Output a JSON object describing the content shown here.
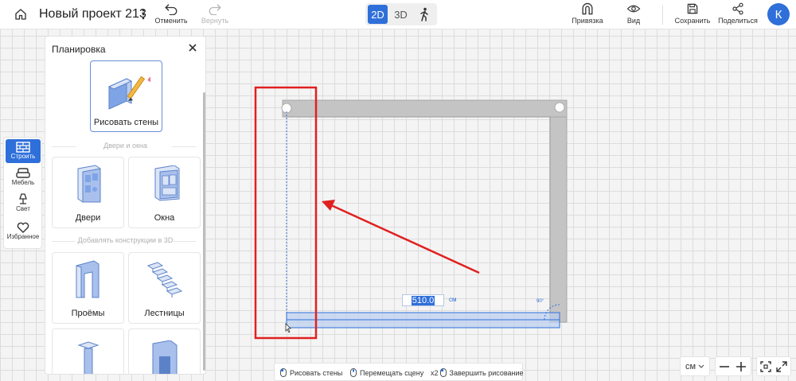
{
  "header": {
    "project_title": "Новый проект 213",
    "undo_label": "Отменить",
    "redo_label": "Вернуть",
    "view_2d": "2D",
    "view_3d": "3D",
    "snap_label": "Привязка",
    "view_label": "Вид",
    "save_label": "Сохранить",
    "share_label": "Поделиться",
    "avatar_letter": "К"
  },
  "rail": {
    "items": [
      {
        "label": "Строить",
        "icon": "brick-wall-icon",
        "active": true
      },
      {
        "label": "Мебель",
        "icon": "sofa-icon"
      },
      {
        "label": "Свет",
        "icon": "lamp-icon"
      },
      {
        "label": "Избранное",
        "icon": "heart-icon"
      }
    ]
  },
  "panel": {
    "title": "Планировка",
    "draw_walls_label": "Рисовать стены",
    "section_doors_windows": "Двери и окна",
    "doors_label": "Двери",
    "windows_label": "Окна",
    "section_constructions": "Добавлять конструкции в 3D",
    "openings_label": "Проёмы",
    "stairs_label": "Лестницы"
  },
  "canvas": {
    "dimension_value": "510.0",
    "dimension_unit": "см",
    "angle_label": "90°"
  },
  "hints": {
    "draw_walls": "Рисовать стены",
    "move_scene": "Перемещать сцену",
    "double_click": "x2",
    "finish_drawing": "Завершить рисование"
  },
  "controls": {
    "unit_select": "см"
  },
  "colors": {
    "accent": "#2f6fd9",
    "annotation_red": "#e02020",
    "wall_gray": "#c4c4c4"
  }
}
